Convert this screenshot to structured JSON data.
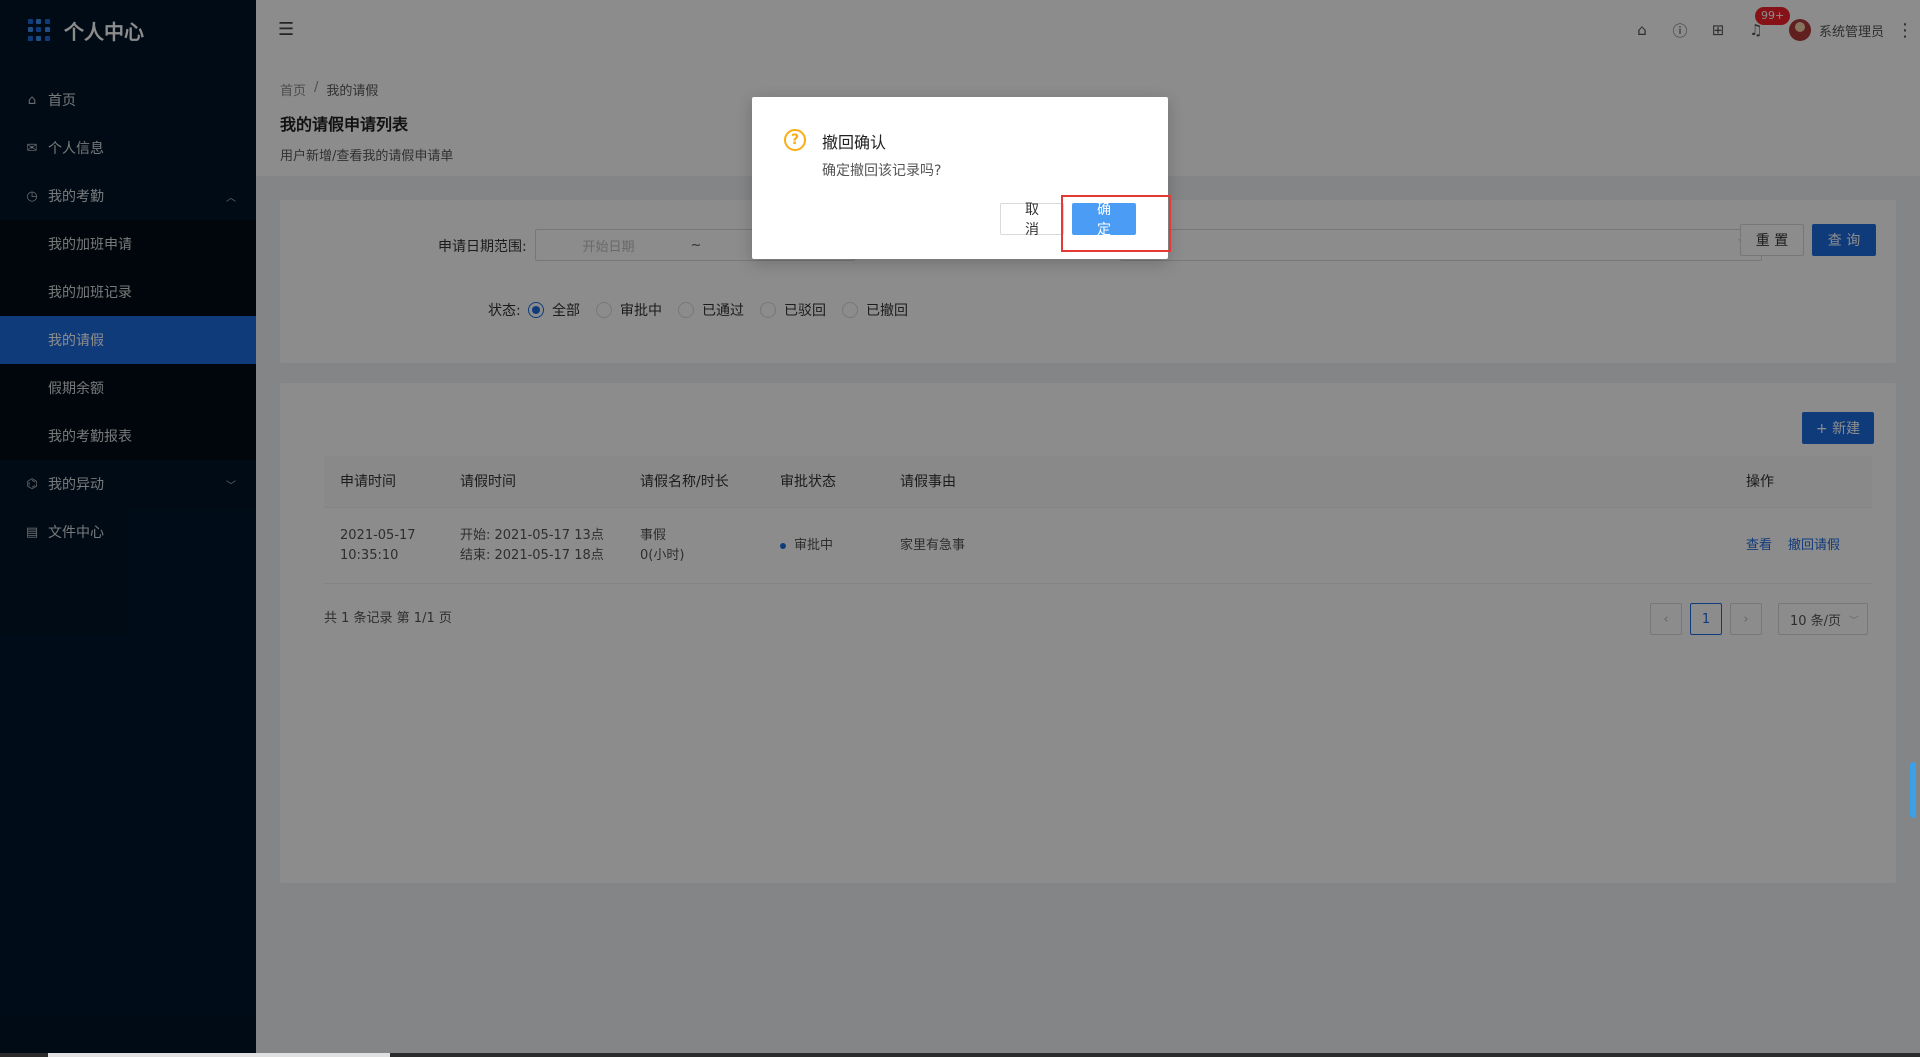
{
  "sidebar": {
    "title": "个人中心",
    "items": [
      {
        "label": "首页",
        "icon": "home-icon"
      },
      {
        "label": "个人信息",
        "icon": "mail-icon"
      },
      {
        "label": "我的考勤",
        "icon": "clock-icon",
        "expanded": true
      },
      {
        "label": "我的异动",
        "icon": "bank-icon"
      },
      {
        "label": "文件中心",
        "icon": "file-icon"
      }
    ],
    "attendance_sub": [
      {
        "label": "我的加班申请"
      },
      {
        "label": "我的加班记录"
      },
      {
        "label": "我的请假",
        "active": true
      },
      {
        "label": "假期余额"
      },
      {
        "label": "我的考勤报表"
      }
    ]
  },
  "header": {
    "notification_count": "99+",
    "username": "系统管理员"
  },
  "page": {
    "breadcrumb": [
      "首页",
      "/",
      "我的请假"
    ],
    "title": "我的请假申请列表",
    "description": "用户新增/查看我的请假申请单"
  },
  "filters": {
    "date_label": "申请日期范围:",
    "date_start_placeholder": "开始日期",
    "date_sep": "~",
    "status_label": "状态:",
    "status_options": [
      "全部",
      "审批中",
      "已通过",
      "已驳回",
      "已撤回"
    ],
    "selected_status": "全部",
    "reset_label": "重 置",
    "query_label": "查 询"
  },
  "table": {
    "new_label": "+ 新建",
    "columns": [
      "申请时间",
      "请假时间",
      "请假名称/时长",
      "审批状态",
      "请假事由",
      "操作"
    ],
    "rows": [
      {
        "apply_date": "2021-05-17",
        "apply_time": "10:35:10",
        "leave_start": "开始: 2021-05-17 13点",
        "leave_end": "结束: 2021-05-17 18点",
        "leave_name": "事假",
        "leave_duration": "0(小时)",
        "status": "审批中",
        "reason": "家里有急事",
        "actions": [
          "查看",
          "撤回请假"
        ]
      }
    ],
    "pager_info": "共 1 条记录 第 1/1 页",
    "current_page": "1",
    "page_size": "10 条/页"
  },
  "modal": {
    "title": "撤回确认",
    "content": "确定撤回该记录吗?",
    "cancel_label": "取 消",
    "ok_label": "确 定"
  },
  "colors": {
    "primary": "#1e6ce0",
    "sidebar_bg": "#001529",
    "warning": "#faad14",
    "highlight": "#e53935"
  }
}
